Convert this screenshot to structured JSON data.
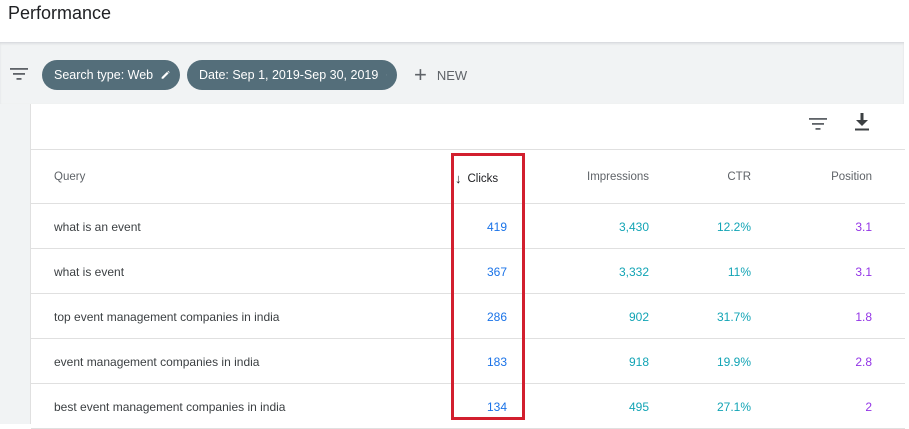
{
  "page": {
    "title": "Performance"
  },
  "filters": {
    "chips": [
      {
        "label": "Search type: Web"
      },
      {
        "label": "Date: Sep 1, 2019-Sep 30, 2019"
      }
    ],
    "new_label": "NEW"
  },
  "table": {
    "columns": [
      "Query",
      "Clicks",
      "Impressions",
      "CTR",
      "Position"
    ],
    "sort": {
      "column": "Clicks",
      "direction": "descending"
    },
    "rows": [
      {
        "query": "what is an event",
        "clicks": "419",
        "impressions": "3,430",
        "ctr": "12.2%",
        "position": "3.1"
      },
      {
        "query": "what is event",
        "clicks": "367",
        "impressions": "3,332",
        "ctr": "11%",
        "position": "3.1"
      },
      {
        "query": "top event management companies in india",
        "clicks": "286",
        "impressions": "902",
        "ctr": "31.7%",
        "position": "1.8"
      },
      {
        "query": "event management companies in india",
        "clicks": "183",
        "impressions": "918",
        "ctr": "19.9%",
        "position": "2.8"
      },
      {
        "query": "best event management companies in india",
        "clicks": "134",
        "impressions": "495",
        "ctr": "27.1%",
        "position": "2"
      }
    ]
  },
  "colors": {
    "chip_bg": "#546e7a",
    "clicks": "#1a73e8",
    "impressions": "#12a4b5",
    "ctr": "#12a4b5",
    "position": "#9334e6",
    "highlight_box": "#d21f2e"
  },
  "icons": [
    "filter-icon",
    "pencil-icon",
    "plus-icon",
    "download-icon",
    "sort-arrow-down-icon"
  ]
}
